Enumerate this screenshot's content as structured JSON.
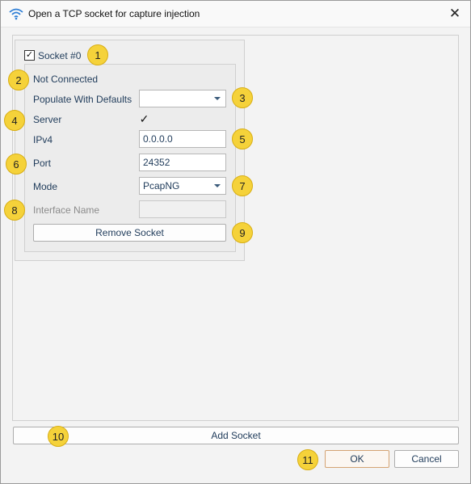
{
  "window": {
    "title": "Open a TCP socket for capture injection",
    "close_label": "✕"
  },
  "socket": {
    "checkbox_label": "Socket #0",
    "checked": true,
    "status": "Not Connected",
    "populate_label": "Populate With Defaults",
    "populate_value": "",
    "server_label": "Server",
    "server_checked": true,
    "ipv4_label": "IPv4",
    "ipv4_value": "0.0.0.0",
    "port_label": "Port",
    "port_value": "24352",
    "mode_label": "Mode",
    "mode_value": "PcapNG",
    "interface_label": "Interface Name",
    "interface_value": "",
    "remove_label": "Remove Socket"
  },
  "footer": {
    "add_socket_label": "Add Socket",
    "ok_label": "OK",
    "cancel_label": "Cancel"
  },
  "badges": [
    "1",
    "2",
    "3",
    "4",
    "5",
    "6",
    "7",
    "8",
    "9",
    "10",
    "11"
  ],
  "colors": {
    "badge_fill": "#f5d23a",
    "label_text": "#1f3b5a",
    "ok_border": "#d4a373"
  }
}
